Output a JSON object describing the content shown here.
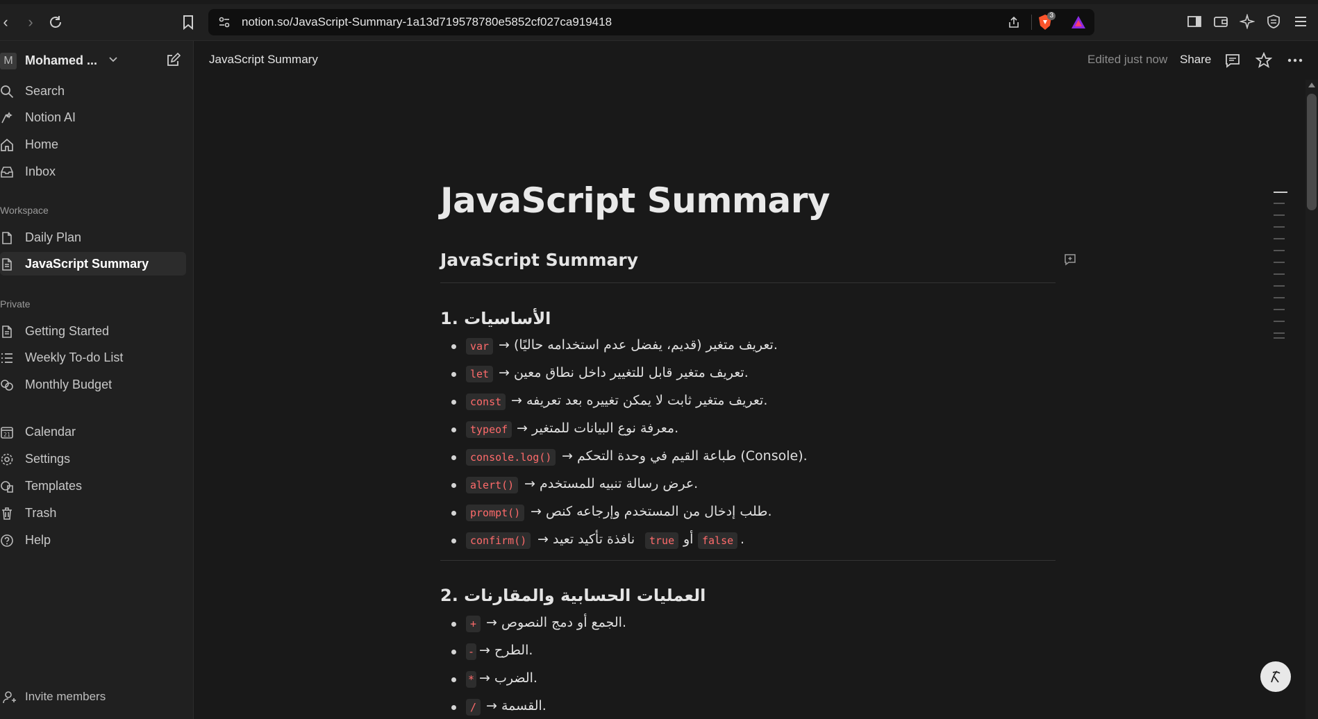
{
  "browser": {
    "url": "notion.so/JavaScript-Summary-1a13d719578780e5852cf027ca919418",
    "shield_badge": "3"
  },
  "sidebar": {
    "workspace_avatar": "M",
    "workspace_name": "Mohamed ...",
    "top_items": [
      {
        "label": "Search",
        "icon": "search-icon"
      },
      {
        "label": "Notion AI",
        "icon": "notion-ai-icon"
      },
      {
        "label": "Home",
        "icon": "home-icon"
      },
      {
        "label": "Inbox",
        "icon": "inbox-icon"
      }
    ],
    "workspace_section": "Workspace",
    "workspace_pages": [
      {
        "label": "Daily Plan"
      },
      {
        "label": "JavaScript Summary",
        "active": true
      }
    ],
    "private_section": "Private",
    "private_pages": [
      {
        "label": "Getting Started"
      },
      {
        "label": "Weekly To-do List"
      },
      {
        "label": "Monthly Budget"
      }
    ],
    "bottom_items": [
      {
        "label": "Calendar",
        "icon": "calendar-icon"
      },
      {
        "label": "Settings",
        "icon": "gear-icon"
      },
      {
        "label": "Templates",
        "icon": "templates-icon"
      },
      {
        "label": "Trash",
        "icon": "trash-icon"
      },
      {
        "label": "Help",
        "icon": "help-icon"
      }
    ],
    "invite_label": "Invite members"
  },
  "topbar": {
    "breadcrumb": "JavaScript Summary",
    "edited": "Edited just now",
    "share": "Share"
  },
  "page": {
    "title": "JavaScript Summary",
    "heading": "JavaScript Summary",
    "section1_title": "1. الأساسيات",
    "section1_items": [
      {
        "code": "var",
        "desc": "→ تعريف متغير (قديم، يفضل عدم استخدامه حاليًا)."
      },
      {
        "code": "let",
        "desc": "→ تعريف متغير قابل للتغيير داخل نطاق معين."
      },
      {
        "code": "const",
        "desc": "→ تعريف متغير ثابت لا يمكن تغييره بعد تعريفه."
      },
      {
        "code": "typeof",
        "desc": "→ معرفة نوع البيانات للمتغير."
      },
      {
        "code": "console.log()",
        "desc": "→ طباعة القيم في وحدة التحكم (Console)."
      },
      {
        "code": "alert()",
        "desc": "→ عرض رسالة تنبيه للمستخدم."
      },
      {
        "code": "prompt()",
        "desc": "→ طلب إدخال من المستخدم وإرجاعه كنص."
      },
      {
        "code": "confirm()",
        "desc": "→ نافذة تأكيد تعيد",
        "code2": "true",
        "mid": "أو",
        "code3": "false",
        "tail": "."
      }
    ],
    "section2_title": "2. العمليات الحسابية والمقارنات",
    "section2_items": [
      {
        "code": "+",
        "desc": "→ الجمع أو دمج النصوص."
      },
      {
        "code": "-",
        "desc": "→ الطرح."
      },
      {
        "code": "*",
        "desc": "→ الضرب."
      },
      {
        "code": "/",
        "desc": "→ القسمة."
      }
    ]
  }
}
